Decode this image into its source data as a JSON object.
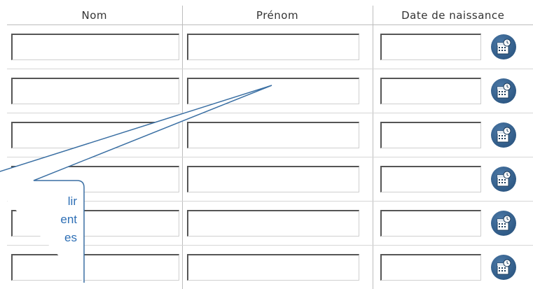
{
  "table": {
    "headers": [
      "Nom",
      "Prénom",
      "Date de naissance"
    ],
    "row_count": 6
  },
  "icons": {
    "calendar": "calendar-icon"
  },
  "callout": {
    "lines": [
      "lir",
      "ent",
      "es"
    ]
  },
  "colors": {
    "calendar_button": "#2f5a86",
    "callout_text": "#2e6fb5",
    "callout_border": "#3a6fa3"
  }
}
